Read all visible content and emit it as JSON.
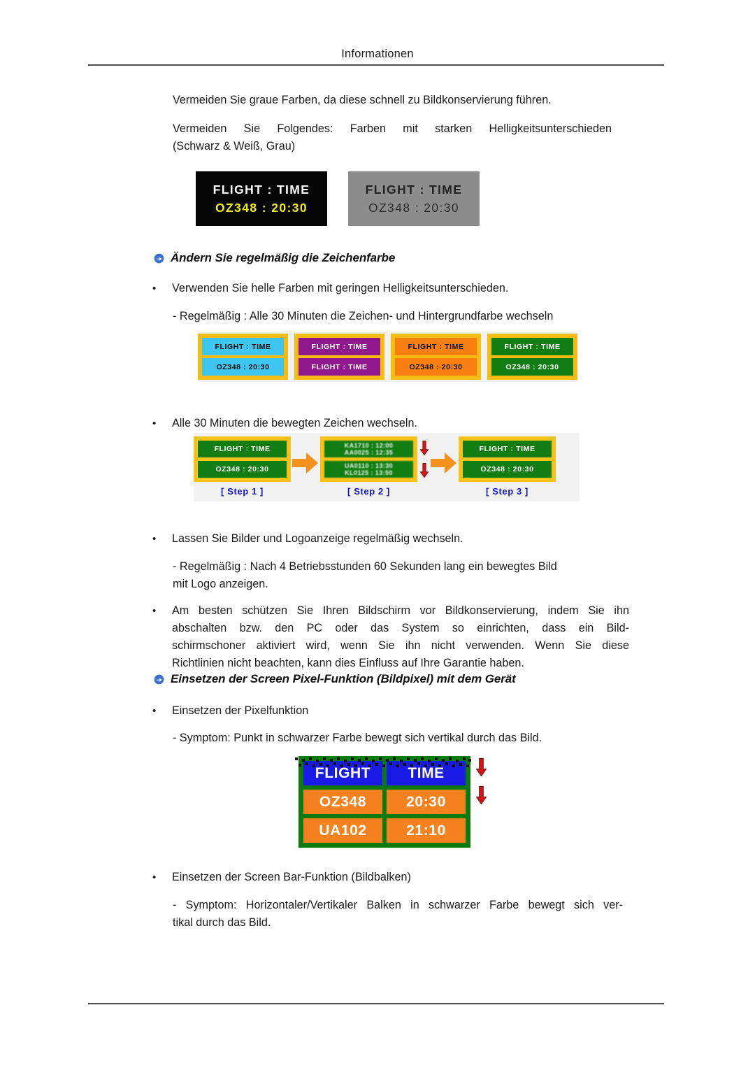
{
  "header": {
    "title": "Informationen"
  },
  "body": {
    "intro_1": "Vermeiden Sie graue Farben, da diese schnell zu Bildkonservierung führen.",
    "intro_2_line1": "Vermeiden Sie Folgendes: Farben mit starken Helligkeitsunterschieden",
    "intro_2_line2": "(Schwarz & Weiß, Grau)",
    "bullet_char": "•",
    "dash_char": "-"
  },
  "section_1": {
    "heading": "Ändern Sie regelmäßig die Zeichenfarbe",
    "bullet_1": "Verwenden Sie helle Farben mit geringen Helligkeitsunterschieden.",
    "sub_1": "- Regelmäßig : Alle 30 Minuten die Zeichen- und Hintergrundfarbe wechseln",
    "bullet_2": "Alle 30 Minuten die bewegten Zeichen wechseln.",
    "bullet_3": "Lassen Sie Bilder und Logoanzeige regelmäßig wechseln.",
    "sub_2_line1": "- Regelmäßig : Nach 4 Betriebsstunden 60 Sekunden lang ein bewegtes Bild",
    "sub_2_line2": "mit Logo anzeigen.",
    "bullet_4_line1": "Am besten schützen Sie Ihren Bildschirm vor Bildkonservierung, indem Sie ihn",
    "bullet_4_line2": "abschalten bzw. den PC oder das System so einrichten, dass ein Bild-",
    "bullet_4_line3": "schirmschoner aktiviert wird, wenn Sie ihn nicht verwenden. Wenn Sie diese",
    "bullet_4_line4": "Richtlinien nicht beachten, kann dies Einfluss auf Ihre Garantie haben."
  },
  "section_2": {
    "heading": "Einsetzen der Screen Pixel-Funktion (Bildpixel) mit dem Gerät",
    "bullet_1": "Einsetzen der Pixelfunktion",
    "sub_1": "- Symptom: Punkt in schwarzer Farbe bewegt sich vertikal durch das Bild.",
    "bullet_2": "Einsetzen der Screen Bar-Funktion (Bildbalken)",
    "sub_2_line1": "- Symptom: Horizontaler/Vertikaler Balken in schwarzer Farbe bewegt sich ver-",
    "sub_2_line2": "tikal durch das Bild."
  },
  "figure_bw": {
    "panels": [
      {
        "id": "black-panel",
        "line1": "FLIGHT : TIME",
        "line2": "OZ348 : 20:30",
        "bg": "#050505",
        "line1_color": "#ffffff",
        "line2_color": "#f2ec1c"
      },
      {
        "id": "gray-panel",
        "line1": "FLIGHT : TIME",
        "line2": "OZ348 : 20:30",
        "bg": "#8d8d8d",
        "line1_color": "#222222",
        "line2_color": "#2b2b2b"
      }
    ]
  },
  "figure_colors": {
    "border_color": "#f7bc12",
    "panels": [
      {
        "id": "cyan-panel",
        "bg": "#3fc6f0",
        "text_color": "#0a0a0a",
        "row1": "FLIGHT : TIME",
        "row2": "OZ348  : 20:30"
      },
      {
        "id": "purple-panel",
        "bg": "#8e1a8e",
        "text_color": "#ffffff",
        "row1": "FLIGHT : TIME",
        "row2": "FLIGHT : TIME"
      },
      {
        "id": "orange-panel",
        "bg": "#f98010",
        "text_color": "#111111",
        "row1": "FLIGHT : TIME",
        "row2": "OZ348  : 20:30"
      },
      {
        "id": "green-panel",
        "bg": "#127d12",
        "text_color": "#ffffff",
        "row1": "FLIGHT : TIME",
        "row2": "OZ348  : 20:30"
      }
    ]
  },
  "figure_steps": {
    "border_color": "#f7c21a",
    "cell_color": "#127d12",
    "label_color": "#1414cc",
    "arrow_color": "#f5921e",
    "red_arrow_color": "#d81414",
    "steps": [
      {
        "label": "[ Step 1 ]",
        "row1": "FLIGHT : TIME",
        "row2": "OZ348  : 20:30"
      },
      {
        "label": "[ Step 2 ]",
        "row1_top": "KA1710 : 12:00",
        "row1_bottom": "AA0025 : 12:35",
        "row2_top": "UA0110 : 13:30",
        "row2_bottom": "KL0125 : 13:50"
      },
      {
        "label": "[ Step 3 ]",
        "row1": "FLIGHT : TIME",
        "row2": "OZ348  : 20:30"
      }
    ]
  },
  "figure_pixel": {
    "border_color": "#0d7a0d",
    "header_bg": "#1a1ae6",
    "data_bg": "#f5821f",
    "text_color": "#ffffff",
    "red_arrow_color": "#d81414",
    "rows": [
      {
        "type": "header",
        "cells": [
          "FLIGHT",
          "TIME"
        ]
      },
      {
        "type": "data",
        "cells": [
          "OZ348",
          "20:30"
        ]
      },
      {
        "type": "data",
        "cells": [
          "UA102",
          "21:10"
        ]
      }
    ]
  }
}
